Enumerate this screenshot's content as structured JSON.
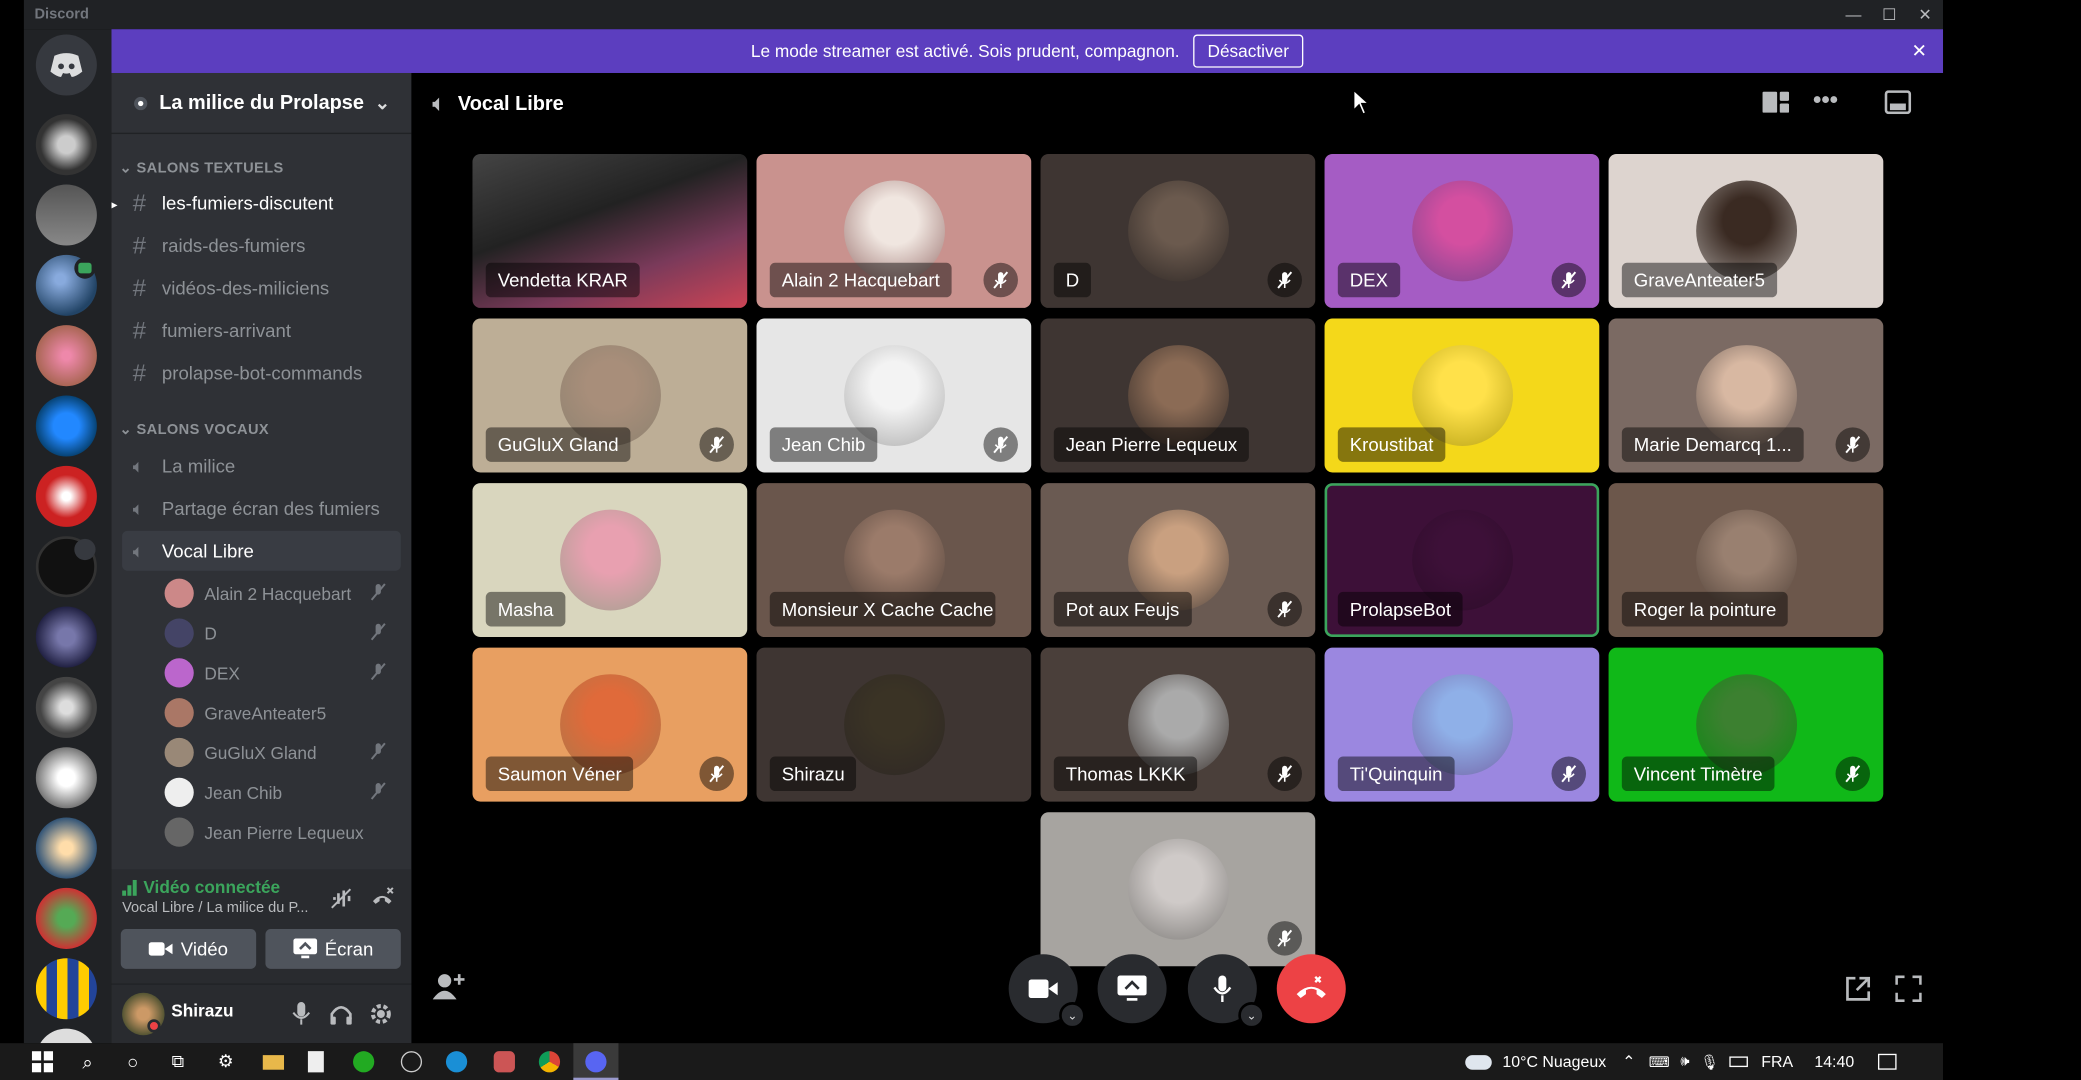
{
  "window": {
    "title": "Discord"
  },
  "streamer_banner": {
    "text": "Le mode streamer est activé. Sois prudent, compagnon.",
    "button": "Désactiver"
  },
  "server": {
    "name": "La milice du Prolapse"
  },
  "categories": {
    "text": "SALONS TEXTUELS",
    "voice": "SALONS VOCAUX"
  },
  "text_channels": [
    "les-fumiers-discutent",
    "raids-des-fumiers",
    "vidéos-des-miliciens",
    "fumiers-arrivant",
    "prolapse-bot-commands"
  ],
  "voice_channels": [
    "La milice",
    "Partage écran des fumiers",
    "Vocal Libre"
  ],
  "voice_users": [
    "Alain 2 Hacquebart",
    "D",
    "DEX",
    "GraveAnteater5",
    "GuGluX Gland",
    "Jean Chib",
    "Jean Pierre Lequeux"
  ],
  "connection": {
    "status": "Vidéo connectée",
    "location": "Vocal Libre / La milice du P...",
    "video_btn": "Vidéo",
    "screen_btn": "Écran"
  },
  "user": {
    "name": "Shirazu"
  },
  "call": {
    "channel": "Vocal Libre"
  },
  "participants": [
    {
      "name": "Vendetta KRAR",
      "muted": false
    },
    {
      "name": "Alain 2 Hacquebart",
      "muted": true
    },
    {
      "name": "D",
      "muted": true
    },
    {
      "name": "DEX",
      "muted": true
    },
    {
      "name": "GraveAnteater5",
      "muted": false
    },
    {
      "name": "GuGluX Gland",
      "muted": true
    },
    {
      "name": "Jean Chib",
      "muted": true
    },
    {
      "name": "Jean Pierre Lequeux",
      "muted": false
    },
    {
      "name": "Kroustibat",
      "muted": false
    },
    {
      "name": "Marie Demarcq 1...",
      "muted": true
    },
    {
      "name": "Masha",
      "muted": false
    },
    {
      "name": "Monsieur X Cache Cache",
      "muted": false
    },
    {
      "name": "Pot aux Feujs",
      "muted": true
    },
    {
      "name": "ProlapseBot",
      "muted": false
    },
    {
      "name": "Roger la pointure",
      "muted": false
    },
    {
      "name": "Saumon Véner",
      "muted": true
    },
    {
      "name": "Shirazu",
      "muted": false
    },
    {
      "name": "Thomas LKKK",
      "muted": true
    },
    {
      "name": "Ti'Quinquin",
      "muted": true
    },
    {
      "name": "Vincent Timètre",
      "muted": true
    },
    {
      "name": "",
      "muted": true
    }
  ],
  "taskbar": {
    "weather": "10°C Nuageux",
    "lang": "FRA",
    "time": "14:40"
  },
  "colors": {
    "brand": "#5865f2",
    "streamer": "#5c3ebf",
    "danger": "#ed4245",
    "online": "#3ba55c"
  }
}
